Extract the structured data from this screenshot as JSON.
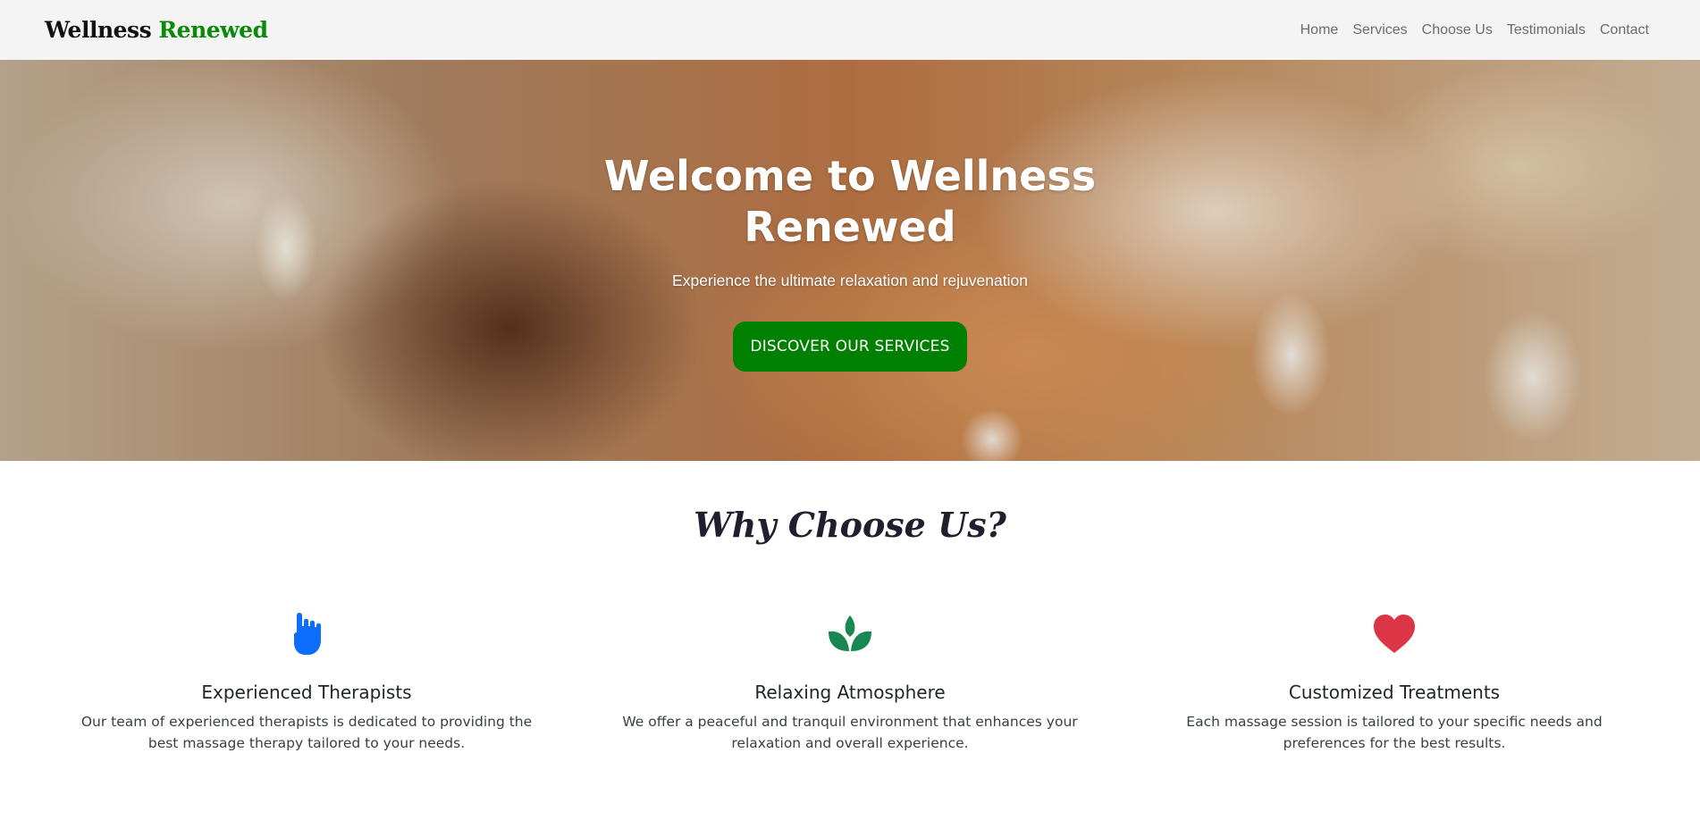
{
  "brand": {
    "part1": "Wellness",
    "part2": "Renewed"
  },
  "nav": {
    "items": [
      "Home",
      "Services",
      "Choose Us",
      "Testimonials",
      "Contact"
    ]
  },
  "hero": {
    "title": "Welcome to Wellness Renewed",
    "subtitle": "Experience the ultimate relaxation and rejuvenation",
    "cta_label": "DISCOVER OUR SERVICES"
  },
  "why": {
    "title": "Why Choose Us?",
    "features": [
      {
        "icon": "hand-icon",
        "icon_color": "#0d6efd",
        "title": "Experienced Therapists",
        "text": "Our team of experienced therapists is dedicated to providing the best massage therapy tailored to your needs."
      },
      {
        "icon": "lotus-icon",
        "icon_color": "#198754",
        "title": "Relaxing Atmosphere",
        "text": "We offer a peaceful and tranquil environment that enhances your relaxation and overall experience."
      },
      {
        "icon": "heart-icon",
        "icon_color": "#dc3545",
        "title": "Customized Treatments",
        "text": "Each massage session is tailored to your specific needs and preferences for the best results."
      }
    ]
  },
  "colors": {
    "brand_green": "#0a8a0a",
    "cta_green": "#008000",
    "navbar_bg": "#f4f4f4"
  }
}
